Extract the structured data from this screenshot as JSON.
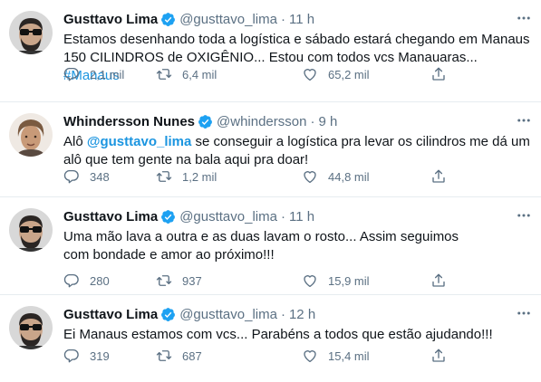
{
  "tweets": [
    {
      "name": "Gusttavo Lima",
      "handle": "@gusttavo_lima",
      "time": "11 h",
      "text_before": "Estamos desenhando toda a logística e sábado estará chegando em Manaus 150 CILINDROS de OXIGÊNIO... Estou com todos vcs Manauaras... ",
      "hashtag": "#Manaus",
      "replies": "2,1 mil",
      "retweets": "6,4 mil",
      "likes": "65,2 mil"
    },
    {
      "name": "Whindersson Nunes",
      "handle": "@whindersson",
      "time": "9 h",
      "text_prefix": "Alô ",
      "mention": "@gusttavo_lima",
      "text_after": " se conseguir a logística pra levar os cilindros me dá um alô que tem gente na bala aqui pra doar!",
      "replies": "348",
      "retweets": "1,2 mil",
      "likes": "44,8 mil"
    },
    {
      "name": "Gusttavo Lima",
      "handle": "@gusttavo_lima",
      "time": "11 h",
      "text": "Uma mão lava a outra e as duas lavam o rosto... Assim seguimos com bondade e amor ao próximo!!!",
      "replies": "280",
      "retweets": "937",
      "likes": "15,9 mil"
    },
    {
      "name": "Gusttavo Lima",
      "handle": "@gusttavo_lima",
      "time": "12 h",
      "text": "Ei Manaus estamos com vcs... Parabéns a todos que estão ajudando!!!",
      "replies": "319",
      "retweets": "687",
      "likes": "15,4 mil"
    }
  ],
  "separator": "·",
  "colors": {
    "verified": "#1da1f2",
    "link": "#1b95e0",
    "secondary_text": "#5b7083",
    "divider": "#e6ecf0"
  },
  "icons": [
    "verified-badge-icon",
    "more-options-icon",
    "reply-icon",
    "retweet-icon",
    "like-icon",
    "share-icon"
  ]
}
